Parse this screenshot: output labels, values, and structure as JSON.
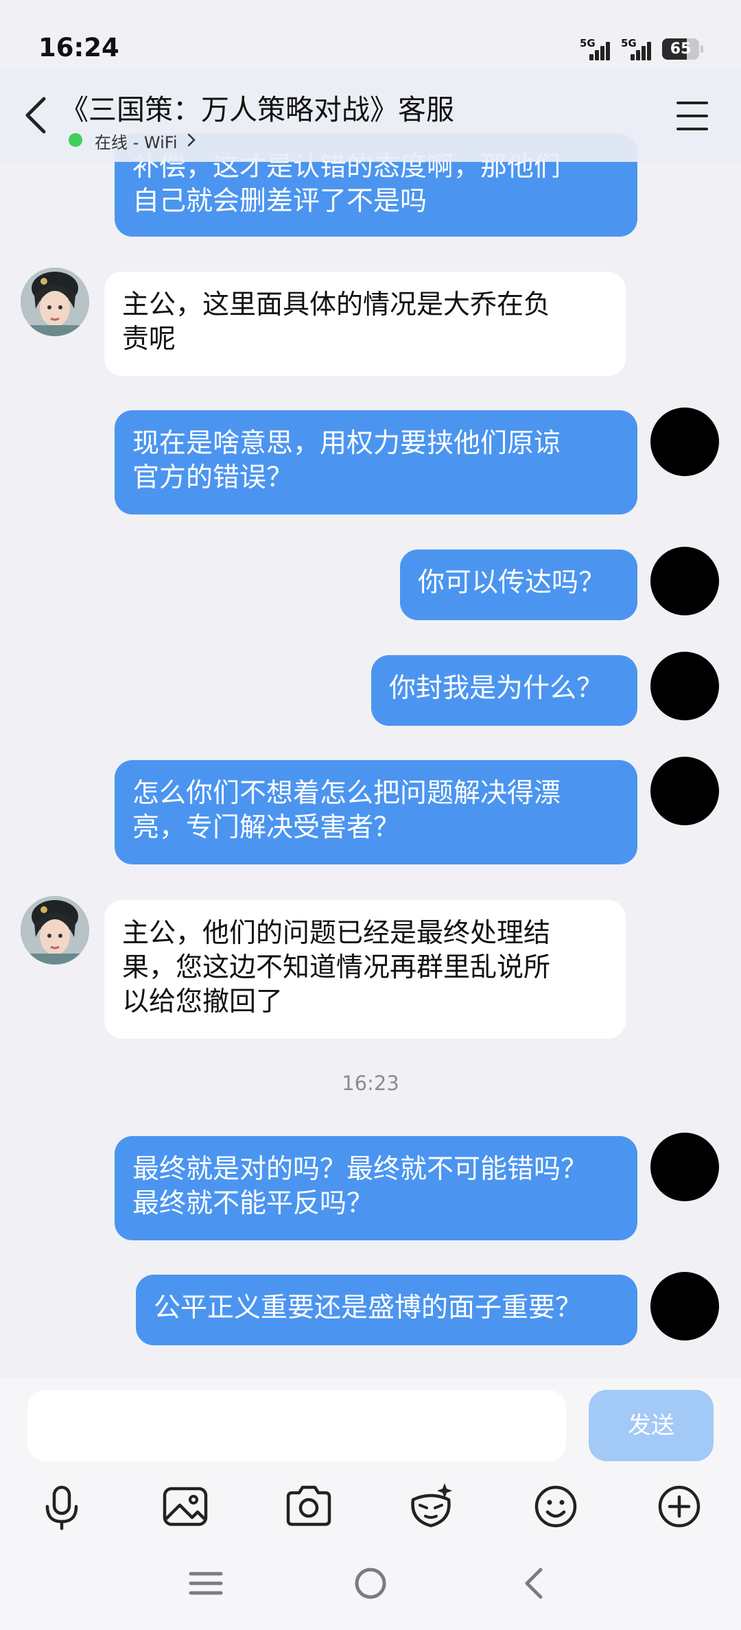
{
  "status_bar": {
    "time": "16:24",
    "network_1": "5G",
    "network_2": "5G",
    "battery": "65"
  },
  "header": {
    "title": "《三国策：万人策略对战》客服",
    "presence": "在线 - WiFi",
    "presence_color": "#3ed05a"
  },
  "messages": [
    {
      "from": "me",
      "text": "补偿，这才是认错的态度啊，那他们\n自己就会删差评了不是吗"
    },
    {
      "from": "agent",
      "text": "主公，这里面具体的情况是大乔在负\n责呢"
    },
    {
      "from": "me",
      "text": "现在是啥意思，用权力要挟他们原谅\n官方的错误？"
    },
    {
      "from": "me",
      "text": "你可以传达吗？"
    },
    {
      "from": "me",
      "text": "你封我是为什么？"
    },
    {
      "from": "me",
      "text": "怎么你们不想着怎么把问题解决得漂\n亮，专门解决受害者？"
    },
    {
      "from": "agent",
      "text": "主公，他们的问题已经是最终处理结\n果，您这边不知道情况再群里乱说所\n以给您撤回了"
    },
    {
      "from": "me",
      "text": "最终就是对的吗？最终就不可能错吗？\n最终就不能平反吗？"
    },
    {
      "from": "me",
      "text": "公平正义重要还是盛博的面子重要？"
    }
  ],
  "timestamp": "16:23",
  "composer": {
    "input_value": "",
    "send_label": "发送",
    "send_color": "#a3c9f6"
  },
  "toolbar_icons": [
    "microphone-icon",
    "image-icon",
    "camera-icon",
    "magic-face-icon",
    "emoji-icon",
    "plus-icon"
  ],
  "colors": {
    "outgoing_bubble": "#4b95f0",
    "incoming_bubble": "#ffffff",
    "background": "#f1f1f5"
  }
}
